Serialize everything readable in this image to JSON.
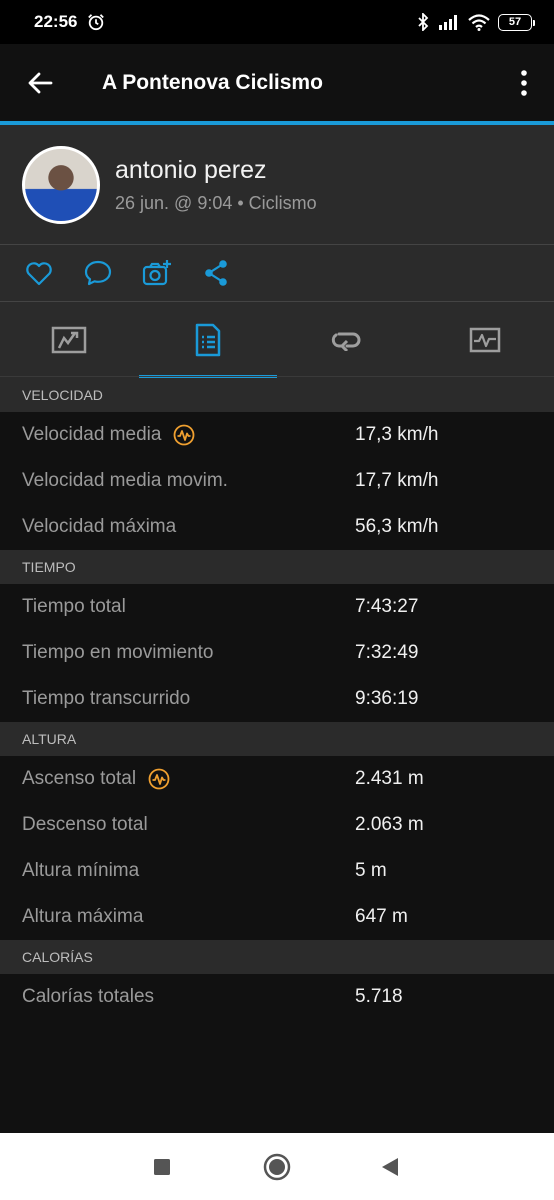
{
  "status_bar": {
    "time": "22:56",
    "battery": "57"
  },
  "app_bar": {
    "title": "A Pontenova Ciclismo"
  },
  "profile": {
    "name": "antonio perez",
    "meta": "26 jun. @ 9:04 • Ciclismo"
  },
  "colors": {
    "accent": "#1a9ad8",
    "badge": "#f0a030",
    "background": "#111111",
    "panel": "#2b2b2b"
  },
  "sections": [
    {
      "header": "VELOCIDAD",
      "rows": [
        {
          "label": "Velocidad media",
          "value": "17,3 km/h",
          "badge": true
        },
        {
          "label": "Velocidad media movim.",
          "value": "17,7 km/h"
        },
        {
          "label": "Velocidad máxima",
          "value": "56,3 km/h"
        }
      ]
    },
    {
      "header": "TIEMPO",
      "rows": [
        {
          "label": "Tiempo total",
          "value": "7:43:27"
        },
        {
          "label": "Tiempo en movimiento",
          "value": "7:32:49"
        },
        {
          "label": "Tiempo transcurrido",
          "value": "9:36:19"
        }
      ]
    },
    {
      "header": "ALTURA",
      "rows": [
        {
          "label": "Ascenso total",
          "value": "2.431 m",
          "badge": true
        },
        {
          "label": "Descenso total",
          "value": "2.063 m"
        },
        {
          "label": "Altura mínima",
          "value": "5 m"
        },
        {
          "label": "Altura máxima",
          "value": "647 m"
        }
      ]
    },
    {
      "header": "CALORÍAS",
      "rows": [
        {
          "label": "Calorías totales",
          "value": "5.718"
        }
      ]
    }
  ]
}
